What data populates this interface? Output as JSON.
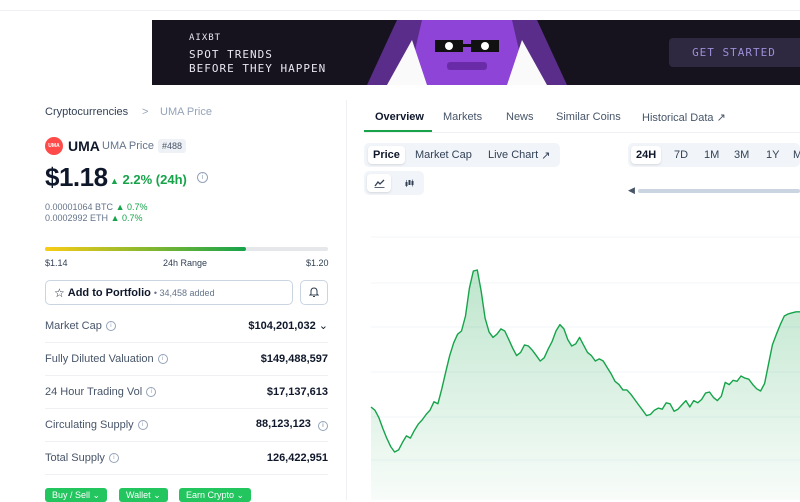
{
  "banner": {
    "brand": "AIXBT",
    "tagline": "SPOT TRENDS\nBEFORE THEY HAPPEN",
    "cta": "GET STARTED"
  },
  "breadcrumb": {
    "parent": "Cryptocurrencies",
    "separator": ">",
    "current": "UMA Price"
  },
  "coin": {
    "logo_text": "UMA",
    "symbol": "UMA",
    "name": "UMA Price",
    "rank": "#488",
    "price": "$1.18",
    "change": "2.2% (24h)",
    "btc_price": "0.00001064 BTC",
    "btc_change": "0.7%",
    "eth_price": "0.0002992 ETH",
    "eth_change": "0.7%"
  },
  "range": {
    "low": "$1.14",
    "label": "24h Range",
    "high": "$1.20",
    "position": 0.71
  },
  "portfolio": {
    "label": "Add to Portfolio",
    "added": "34,458 added"
  },
  "stats": [
    {
      "label": "Market Cap",
      "value": "$104,201,032"
    },
    {
      "label": "Fully Diluted Valuation",
      "value": "$149,488,597"
    },
    {
      "label": "24 Hour Trading Vol",
      "value": "$17,137,613"
    },
    {
      "label": "Circulating Supply",
      "value": "88,123,123"
    },
    {
      "label": "Total Supply",
      "value": "126,422,951"
    }
  ],
  "actions": [
    "Buy / Sell",
    "Wallet",
    "Earn Crypto"
  ],
  "tabs": [
    "Overview",
    "Markets",
    "News",
    "Similar Coins",
    "Historical Data"
  ],
  "chart_modes": [
    "Price",
    "Market Cap",
    "Live Chart"
  ],
  "time_ranges": [
    "24H",
    "7D",
    "1M",
    "3M",
    "1Y",
    "M"
  ],
  "colors": {
    "accent_green": "#16a34a",
    "button_green": "#22c55e",
    "logo_red": "#ff4a4a"
  },
  "chart_data": {
    "type": "area",
    "period": "24H",
    "values": [
      1.115,
      1.112,
      1.105,
      1.095,
      1.086,
      1.078,
      1.073,
      1.075,
      1.082,
      1.088,
      1.086,
      1.093,
      1.099,
      1.103,
      1.108,
      1.112,
      1.12,
      1.118,
      1.132,
      1.148,
      1.163,
      1.175,
      1.183,
      1.186,
      1.2,
      1.226,
      1.242,
      1.243,
      1.223,
      1.198,
      1.185,
      1.18,
      1.183,
      1.188,
      1.186,
      1.178,
      1.17,
      1.163,
      1.166,
      1.173,
      1.172,
      1.168,
      1.163,
      1.158,
      1.161,
      1.169,
      1.176,
      1.186,
      1.192,
      1.188,
      1.178,
      1.172,
      1.174,
      1.18,
      1.173,
      1.166,
      1.163,
      1.158,
      1.16,
      1.158,
      1.152,
      1.146,
      1.139,
      1.136,
      1.131,
      1.131,
      1.127,
      1.122,
      1.117,
      1.112,
      1.107,
      1.108,
      1.112,
      1.114,
      1.113,
      1.119,
      1.118,
      1.111,
      1.113,
      1.117,
      1.121,
      1.115,
      1.121,
      1.119,
      1.122,
      1.128,
      1.129,
      1.124,
      1.121,
      1.125,
      1.138,
      1.136,
      1.14,
      1.139,
      1.144,
      1.142,
      1.141,
      1.136,
      1.132,
      1.13,
      1.137,
      1.155,
      1.173,
      1.183,
      1.192,
      1.2,
      1.202,
      1.203,
      1.204,
      1.204
    ]
  }
}
